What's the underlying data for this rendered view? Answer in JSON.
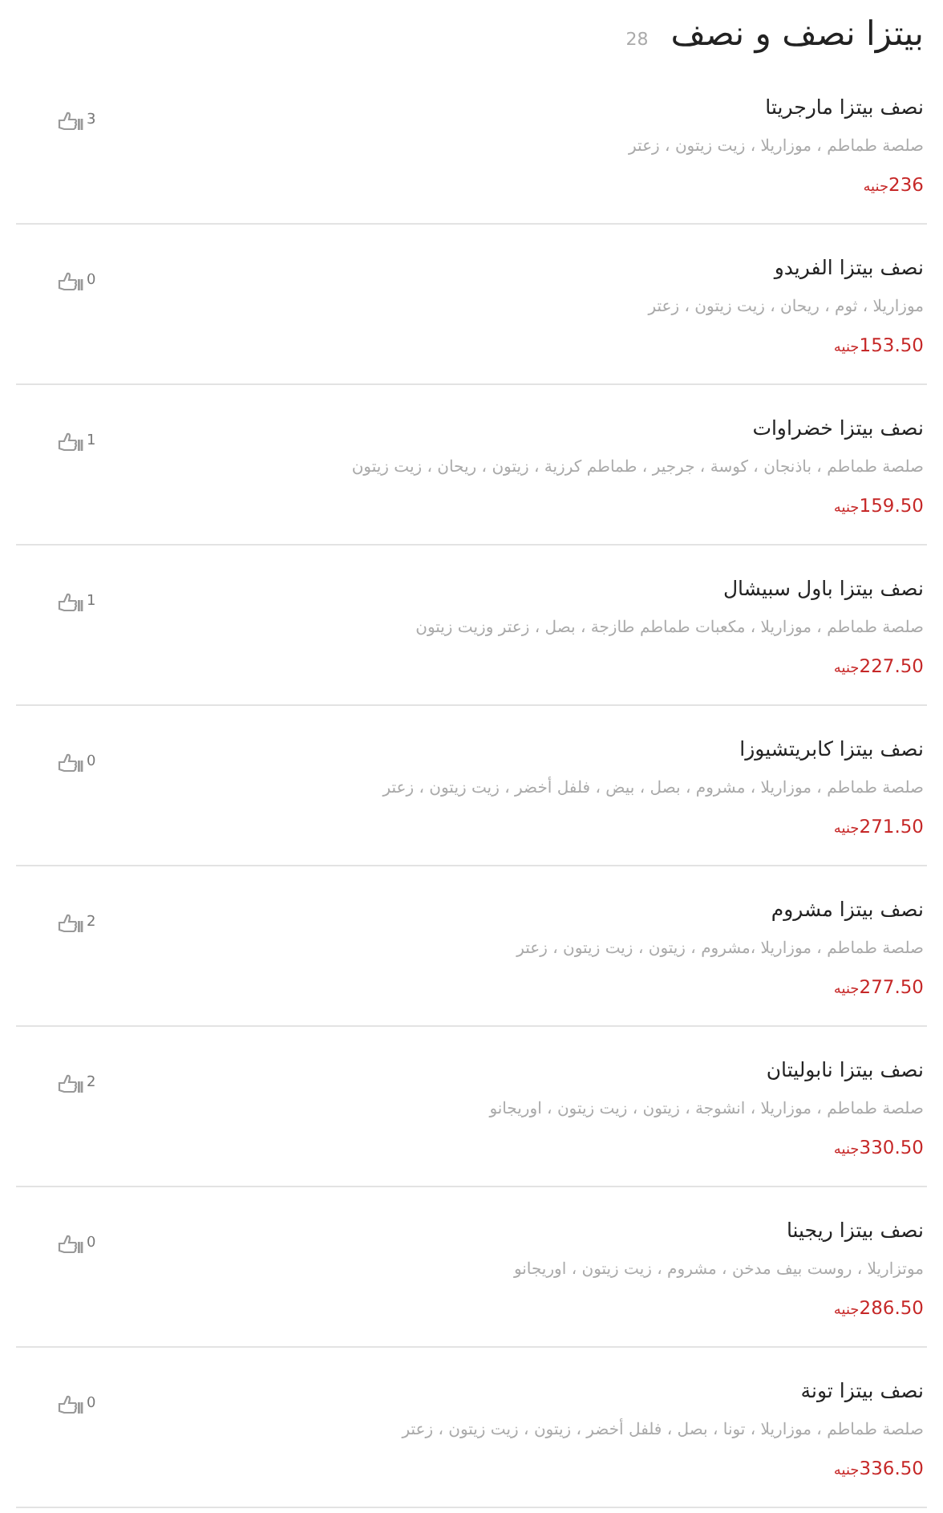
{
  "header": {
    "title": "بيتزا نصف و نصف",
    "count": "28"
  },
  "items": [
    {
      "name": "نصف بيتزا مارجريتا",
      "ingredients": "صلصة طماطم ، موزاريلا ، زيت زيتون ، زعتر",
      "price": "236",
      "currency": "جنيه",
      "likes": "3"
    },
    {
      "name": "نصف بيتزا الفريدو",
      "ingredients": "موزاريلا ، ثوم ، ريحان ، زيت زيتون ، زعتر",
      "price": "153.50",
      "currency": "جنيه",
      "likes": "0"
    },
    {
      "name": "نصف بيتزا خضراوات",
      "ingredients": "صلصة طماطم ، باذنجان ، كوسة ، جرجير ، طماطم كرزية ، زيتون ، ريحان ، زيت زيتون",
      "price": "159.50",
      "currency": "جنيه",
      "likes": "1"
    },
    {
      "name": "نصف بيتزا باول سبيشال",
      "ingredients": "صلصة طماطم ، موزاريلا ، مكعبات طماطم طازجة ، بصل ، زعتر وزيت زيتون",
      "price": "227.50",
      "currency": "جنيه",
      "likes": "1"
    },
    {
      "name": "نصف بيتزا كابريتشيوزا",
      "ingredients": "صلصة طماطم ، موزاريلا ، مشروم ، بصل ، بيض ، فلفل أخضر ، زيت زيتون ، زعتر",
      "price": "271.50",
      "currency": "جنيه",
      "likes": "0"
    },
    {
      "name": "نصف بيتزا مشروم",
      "ingredients": "صلصة طماطم ، موزاريلا ،مشروم ، زيتون ، زيت زيتون ، زعتر",
      "price": "277.50",
      "currency": "جنيه",
      "likes": "2"
    },
    {
      "name": "نصف بيتزا نابوليتان",
      "ingredients": "صلصة طماطم ، موزاريلا ، انشوجة ، زيتون ، زيت زيتون ، اوريجانو",
      "price": "330.50",
      "currency": "جنيه",
      "likes": "2"
    },
    {
      "name": "نصف بيتزا ريجينا",
      "ingredients": "موتزاريلا ، روست بيف مدخن ، مشروم ، زيت زيتون ، اوريجانو",
      "price": "286.50",
      "currency": "جنيه",
      "likes": "0"
    },
    {
      "name": "نصف بيتزا تونة",
      "ingredients": "صلصة طماطم ، موزاريلا ، تونا ، بصل ، فلفل أخضر ، زيتون ، زيت زيتون ، زعتر",
      "price": "336.50",
      "currency": "جنيه",
      "likes": "0"
    }
  ]
}
